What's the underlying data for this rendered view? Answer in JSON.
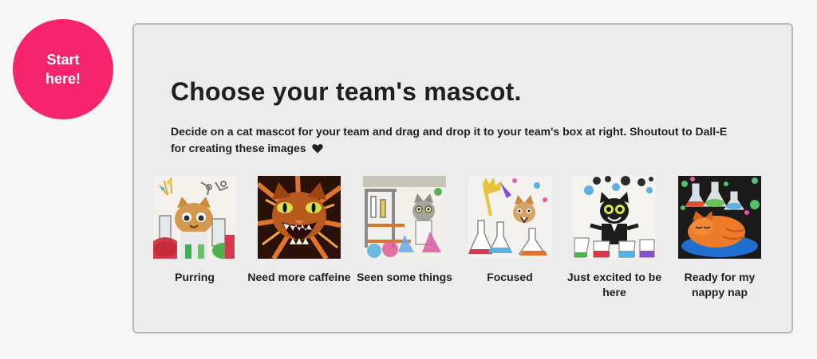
{
  "start": {
    "line1": "Start",
    "line2": "here!"
  },
  "panel": {
    "title": "Choose your team's mascot.",
    "description": "Decide on a cat mascot for your team and drag and drop it to your team's box at right. Shoutout to Dall-E for creating these images",
    "heart_icon": "heart-icon"
  },
  "mascots": [
    {
      "label": "Purring",
      "image": "cat-scientist-purring"
    },
    {
      "label": "Need more caffeine",
      "image": "cat-screaming-caffeine"
    },
    {
      "label": "Seen some things",
      "image": "cat-lab-seen-things"
    },
    {
      "label": "Focused",
      "image": "cat-flasks-focused"
    },
    {
      "label": "Just excited to be here",
      "image": "cat-black-excited"
    },
    {
      "label": "Ready for my nappy nap",
      "image": "cat-orange-napping"
    }
  ],
  "colors": {
    "start_badge": "#f6246c",
    "panel_bg": "#ececec",
    "panel_border": "#b9b9b9"
  }
}
